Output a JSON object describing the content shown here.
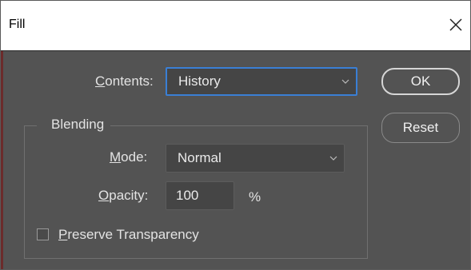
{
  "window": {
    "title": "Fill",
    "close_icon": "close-icon"
  },
  "contents": {
    "label_access": "C",
    "label_rest": "ontents:",
    "value": "History"
  },
  "blending": {
    "legend": "Blending",
    "mode": {
      "label_access": "M",
      "label_rest": "ode:",
      "value": "Normal"
    },
    "opacity": {
      "label_access": "O",
      "label_rest": "pacity:",
      "value": "100",
      "unit": "%"
    },
    "preserve_transparency": {
      "label_access": "P",
      "label_rest": "reserve Transparency",
      "checked": false
    }
  },
  "buttons": {
    "ok": "OK",
    "reset": "Reset"
  },
  "colors": {
    "dialog_bg": "#535353",
    "focus_border": "#3a7fd5",
    "text": "#e3e3e3"
  }
}
